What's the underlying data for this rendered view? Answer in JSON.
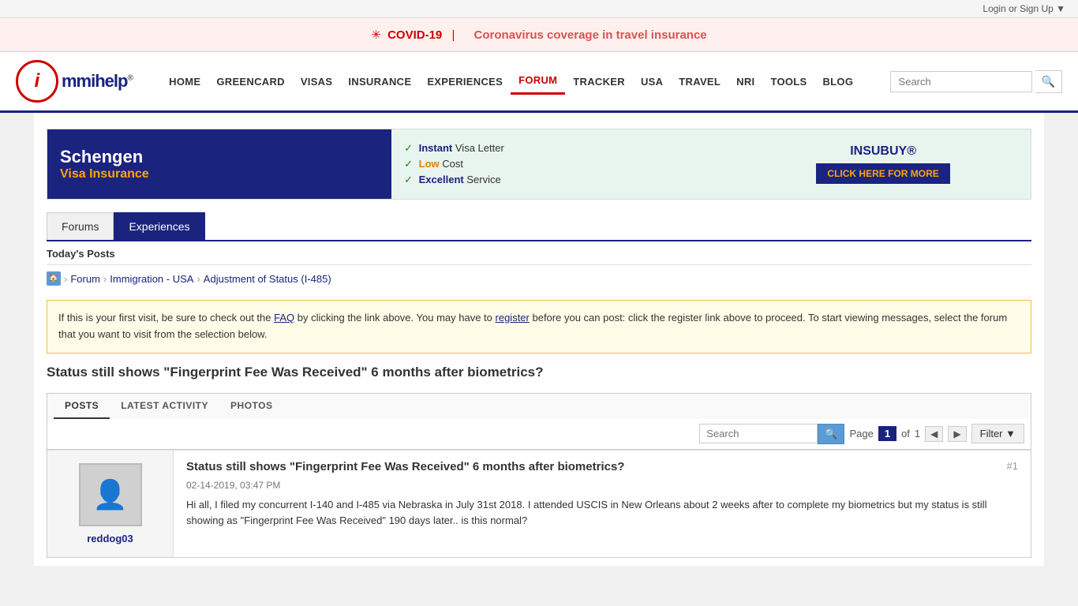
{
  "topbar": {
    "login_label": "Login or Sign Up ▼"
  },
  "covid_banner": {
    "icon": "✳",
    "title": "COVID-19",
    "separator": "|",
    "link_text": "Coronavirus coverage in travel insurance"
  },
  "header": {
    "logo": {
      "letter": "i",
      "brand": "mmihelp",
      "registered": "®",
      "star": "★"
    },
    "search_placeholder": "Search",
    "search_icon": "🔍"
  },
  "nav": {
    "items": [
      {
        "label": "HOME",
        "active": false
      },
      {
        "label": "GREENCARD",
        "active": false
      },
      {
        "label": "VISAS",
        "active": false
      },
      {
        "label": "INSURANCE",
        "active": false
      },
      {
        "label": "EXPERIENCES",
        "active": false
      },
      {
        "label": "FORUM",
        "active": true
      },
      {
        "label": "TRACKER",
        "active": false
      },
      {
        "label": "USA",
        "active": false
      },
      {
        "label": "TRAVEL",
        "active": false
      },
      {
        "label": "NRI",
        "active": false
      },
      {
        "label": "TOOLS",
        "active": false
      },
      {
        "label": "BLOG",
        "active": false
      }
    ]
  },
  "ad": {
    "brand": "Schengen",
    "sub": "Visa Insurance",
    "feature1_check": "✓",
    "feature1_bold": "Instant",
    "feature1_rest": " Visa Letter",
    "feature2_check": "✓",
    "feature2_bold": "Low",
    "feature2_rest": " Cost",
    "feature3_check": "✓",
    "feature3_bold": "Excellent",
    "feature3_rest": " Service",
    "insubuy": "INSUBUY®",
    "click_btn": "CLICK HERE FOR MORE"
  },
  "tabs": {
    "forums": "Forums",
    "experiences": "Experiences"
  },
  "todays_posts": "Today's Posts",
  "breadcrumb": {
    "home": "🏠",
    "forum": "Forum",
    "immigration": "Immigration - USA",
    "category": "Adjustment of Status (I-485)"
  },
  "notice": {
    "text_before_faq": "If this is your first visit, be sure to check out the ",
    "faq_link": "FAQ",
    "text_after_faq": " by clicking the link above. You may have to ",
    "register_link": "register",
    "text_after_register": " before you can post: click the register link above to proceed. To start viewing messages, select the forum that you want to visit from the selection below."
  },
  "thread": {
    "title": "Status still shows \"Fingerprint Fee Was Received\" 6 months after biometrics?"
  },
  "post_tabs": {
    "posts": "POSTS",
    "latest_activity": "LATEST ACTIVITY",
    "photos": "PHOTOS"
  },
  "pagination": {
    "search_placeholder": "Search",
    "page_label": "Page",
    "current_page": "1",
    "of_label": "of",
    "total_pages": "1",
    "filter_label": "Filter ▼"
  },
  "post": {
    "title": "Status still shows \"Fingerprint Fee Was Received\" 6 months after biometrics?",
    "post_number": "#1",
    "date": "02-14-2019, 03:47 PM",
    "username": "reddog03",
    "avatar_icon": "👤",
    "content": "Hi all, I filed my concurrent I-140 and I-485 via Nebraska in July 31st 2018. I attended USCIS in New Orleans about 2 weeks after to complete my biometrics but my status is still showing as \"Fingerprint Fee Was Received\" 190 days later.. is this normal?"
  }
}
